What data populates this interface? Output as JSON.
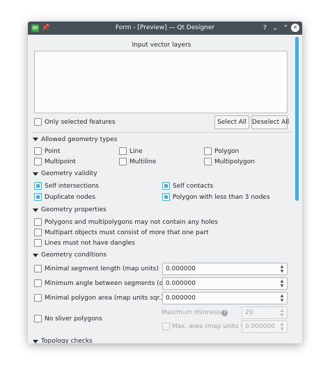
{
  "window": {
    "title": "Form - [Preview] — Qt Designer",
    "app_icon_text": "Qt",
    "help_glyph": "?",
    "min_glyph": "⌄",
    "max_glyph": "⌃",
    "close_glyph": "✕",
    "pin_glyph": "📌"
  },
  "input_layers": {
    "heading": "Input vector layers",
    "only_selected_label": "Only selected features",
    "select_all_label": "Select All",
    "deselect_all_label": "Deselect All"
  },
  "allowed_geometry_types": {
    "heading": "Allowed geometry types",
    "options": [
      "Point",
      "Line",
      "Polygon",
      "Multipoint",
      "Multiline",
      "Multipolygon"
    ]
  },
  "geometry_validity": {
    "heading": "Geometry validity",
    "options": [
      "Self intersections",
      "Self contacts",
      "Duplicate nodes",
      "Polygon with less than 3 nodes"
    ]
  },
  "geometry_properties": {
    "heading": "Geometry properties",
    "options": [
      "Polygons and multipolygons may not contain any holes",
      "Multipart objects must consist of more that one part",
      "Lines must not have dangles"
    ]
  },
  "geometry_conditions": {
    "heading": "Geometry conditions",
    "min_segment_length": {
      "label": "Minimal segment length (map units)",
      "value": "0.000000"
    },
    "min_angle": {
      "label": "Minimum angle between segments (deg)",
      "value": "0.000000"
    },
    "min_polygon_area": {
      "label": "Minimal polygon area (map units sqr.)",
      "value": "0.000000"
    },
    "no_sliver": {
      "label": "No sliver polygons"
    },
    "max_thinness": {
      "label": "Maximum thinness",
      "value": "20"
    },
    "max_area": {
      "label": "Max. area (map units sqr.)",
      "value": "0.000000"
    }
  },
  "topology_checks": {
    "heading": "Topology checks"
  },
  "colors": {
    "accent": "#3daee9",
    "titlebar": "#475057",
    "window_bg": "#eff0f1"
  }
}
